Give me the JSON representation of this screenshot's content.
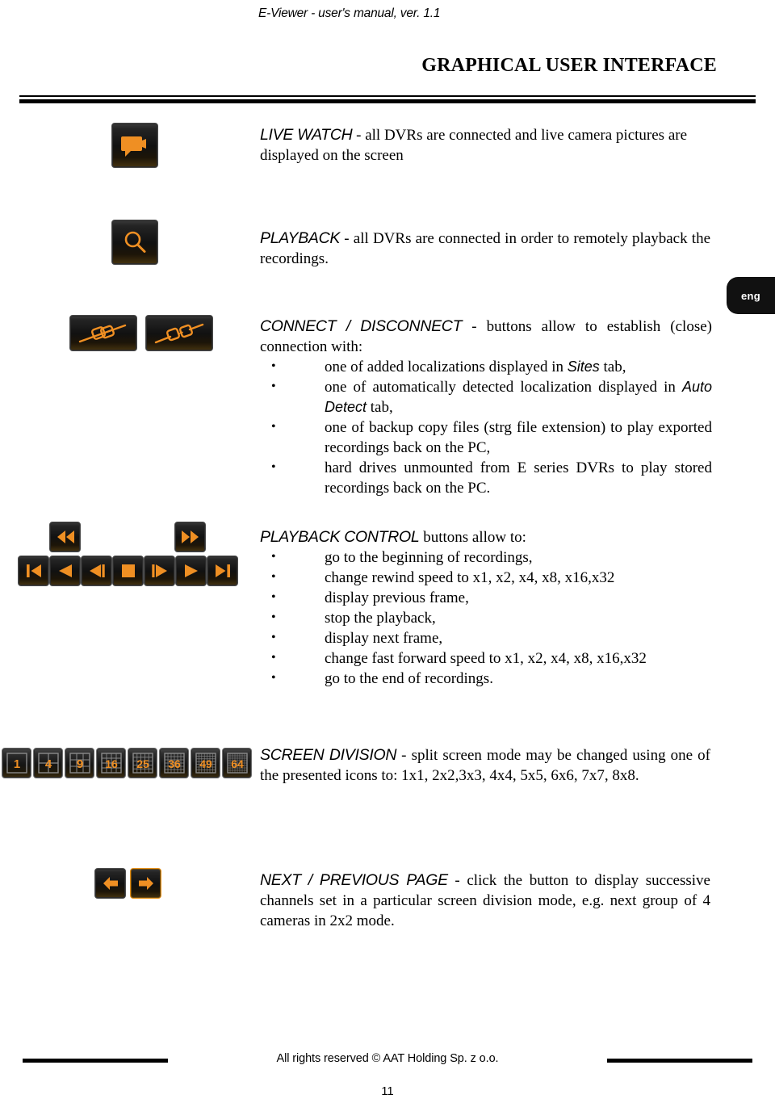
{
  "header": {
    "running_title": "E-Viewer - user's manual, ver. 1.1"
  },
  "chapter": {
    "title": "GRAPHICAL USER INTERFACE"
  },
  "lang_tab": {
    "label": "eng"
  },
  "sections": [
    {
      "id": "live-watch",
      "lead": "LIVE WATCH",
      "body": " - all DVRs are connected and live camera pictures are displayed on the screen",
      "icons": [
        "camera-icon"
      ]
    },
    {
      "id": "playback",
      "lead": "PLAYBACK",
      "body": " - all DVRs are connected in order to remotely playback the recordings.",
      "icons": [
        "magnifier-icon"
      ]
    },
    {
      "id": "connect-disconnect",
      "lead": "CONNECT / DISCONNECT",
      "body": " - buttons allow to establish (close) connection with:",
      "icons": [
        "chain-linked-icon",
        "chain-broken-icon"
      ],
      "bullets": [
        {
          "pre": "one of added localizations displayed in ",
          "em": "Sites",
          "post": " tab,"
        },
        {
          "pre": "one of automatically detected localization displayed in ",
          "em": "Auto Detect",
          "post": " tab,"
        },
        {
          "pre": "one of backup copy files (strg file extension) to play exported recordings back on the PC,",
          "em": "",
          "post": ""
        },
        {
          "pre": "hard drives unmounted from E series DVRs to play stored recordings back on the PC.",
          "em": "",
          "post": ""
        }
      ]
    },
    {
      "id": "playback-control",
      "lead": "PLAYBACK CONTROL",
      "body": " buttons allow to:",
      "bullets": [
        {
          "pre": "go to the beginning of recordings,",
          "em": "",
          "post": ""
        },
        {
          "pre": "change rewind speed to x1, x2, x4, x8, x16,x32",
          "em": "",
          "post": ""
        },
        {
          "pre": "display previous frame,",
          "em": "",
          "post": ""
        },
        {
          "pre": "stop the playback,",
          "em": "",
          "post": ""
        },
        {
          "pre": "display next frame,",
          "em": "",
          "post": ""
        },
        {
          "pre": "change fast forward speed to x1, x2, x4, x8, x16,x32",
          "em": "",
          "post": ""
        },
        {
          "pre": "go to the end of recordings.",
          "em": "",
          "post": ""
        }
      ],
      "icons": [
        "rewind-icon",
        "fast-forward-icon",
        "skip-to-start-icon",
        "play-reverse-icon",
        "step-back-icon",
        "stop-icon",
        "step-forward-icon",
        "play-icon",
        "skip-to-end-icon"
      ]
    },
    {
      "id": "screen-division",
      "lead": "SCREEN DIVISION",
      "body": " - split screen mode may be changed using one of the presented icons to: 1x1, 2x2,3x3, 4x4, 5x5, 6x6, 7x7, 8x8.",
      "division_labels": [
        "1",
        "4",
        "9",
        "16",
        "25",
        "36",
        "49",
        "64"
      ]
    },
    {
      "id": "next-previous-page",
      "lead": "NEXT / PREVIOUS PAGE",
      "body": " - click the button to display successive channels set in a particular screen division mode, e.g. next group of 4 cameras in 2x2 mode.",
      "icons": [
        "arrow-left-icon",
        "arrow-right-icon"
      ]
    }
  ],
  "footer": {
    "copyright": "All rights reserved © AAT Holding Sp. z o.o.",
    "page_number": "11"
  },
  "colors": {
    "accent_orange": "#ef8f23",
    "button_dark": "#111111",
    "tab_black": "#111111"
  }
}
